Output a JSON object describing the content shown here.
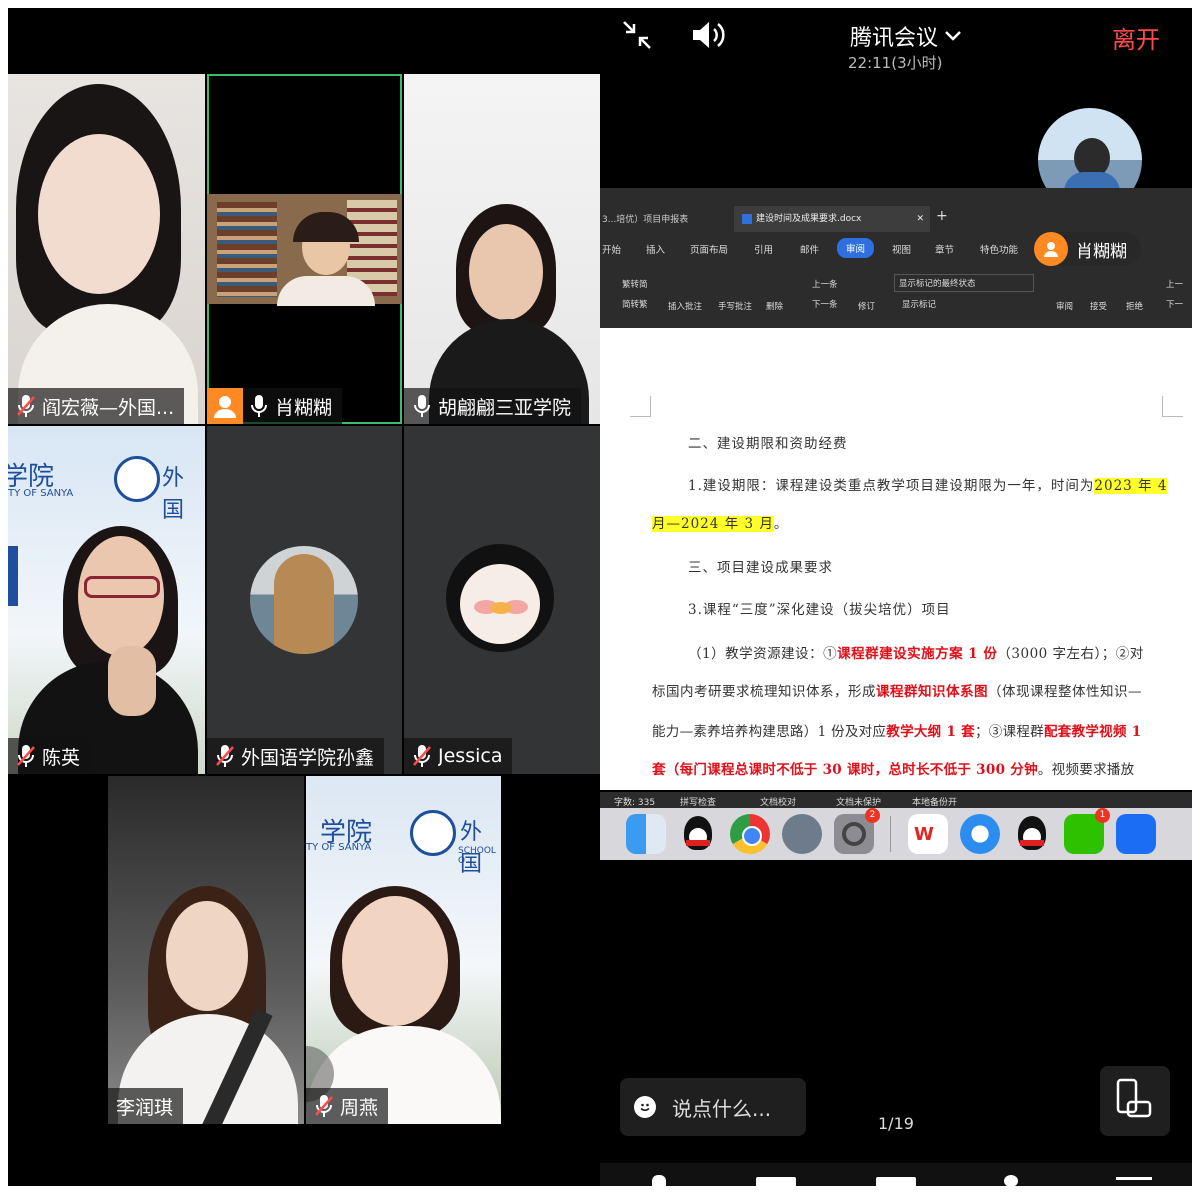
{
  "header": {
    "app_title": "腾讯会议",
    "duration": "22:11(3小时)",
    "leave_label": "离开"
  },
  "participants": [
    {
      "name": "阎宏薇—外国..."
    },
    {
      "name": "肖糊糊"
    },
    {
      "name": "胡翩翩三亚学院"
    },
    {
      "name": "陈英"
    },
    {
      "name": "外国语学院孙鑫"
    },
    {
      "name": "Jessica"
    },
    {
      "name": "李润琪"
    },
    {
      "name": "周燕"
    }
  ],
  "background_texts": {
    "school_cn": "学院",
    "school_en": "TY OF SANYA",
    "foreign_cn": "外国",
    "school_of": "SCHOOL O"
  },
  "share": {
    "presenter_name": "肖糊糊",
    "doc_tab_1": "3...培优）项目申报表",
    "doc_tab_2": "建设时间及成果要求.docx",
    "ribbon_tabs": [
      "开始",
      "插入",
      "页面布局",
      "引用",
      "邮件",
      "审阅",
      "视图",
      "章节",
      "特色功能"
    ],
    "active_ribbon_tab": "审阅",
    "ribbon_tools": [
      "繁转简",
      "简转繁",
      "插入批注",
      "手写批注",
      "删除",
      "上一条",
      "下一条",
      "修订",
      "显示标记的最终状态",
      "显示标记",
      "审阅",
      "接受",
      "拒绝",
      "上一",
      "下一"
    ],
    "doc_lines": {
      "l1": "二、建设期限和资助经费",
      "l2a": "1.建设期限：课程建设类重点教学项目建设期限为一年，时间为",
      "l2b": "2023 年 4",
      "l3a": "月—2024 年 3 月",
      "l3b": "。",
      "l4": "三、项目建设成果要求",
      "l5": "3.课程“三度”深化建设（拔尖培优）项目",
      "l6a": "（1）教学资源建设：①",
      "l6b": "课程群建设实施方案 1 份",
      "l6c": "（3000 字左右）；②对",
      "l7a": "标国内考研要求梳理知识体系，形成",
      "l7b": "课程群知识体系图",
      "l7c": "（体现课程整体性知识—",
      "l8a": "能力—素养培养构建思路）1 份及对应",
      "l8b": "教学大纲 1 套",
      "l8c": "；③课程群",
      "l8d": "配套教学视频 1",
      "l9a": "套（每门课程总课时不低于 30 课时，总时长不低于 300 分钟",
      "l9b": "。视频要求播放"
    },
    "status_bar": [
      "字数: 335",
      "拼写检查",
      "文档校对",
      "文档未保护",
      "本地备份开"
    ],
    "dock_badges": {
      "settings": "2",
      "wechat": "1"
    },
    "page_indicator": "1/19"
  },
  "chat_input": {
    "placeholder": "说点什么..."
  },
  "colors": {
    "leave": "#ff4a4a",
    "active_speaker": "#3dbd69",
    "highlight": "#ffff29",
    "red_text": "#e0101a"
  }
}
